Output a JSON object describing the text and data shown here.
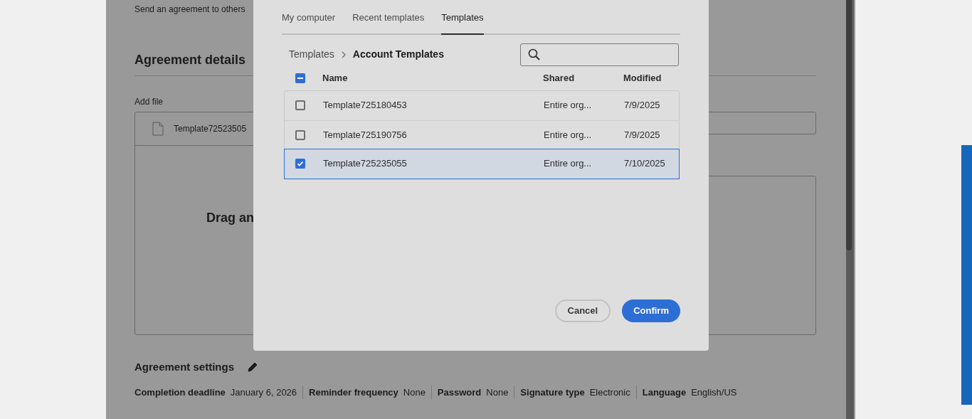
{
  "background_page": {
    "description": "Send an agreement to others",
    "section_title": "Agreement details",
    "add_file": {
      "label": "Add file",
      "file_name": "Template72523505",
      "drop_text": "Drag an"
    },
    "settings": {
      "title": "Agreement settings",
      "items": [
        {
          "label": "Completion deadline",
          "value": "January 6, 2026"
        },
        {
          "label": "Reminder frequency",
          "value": "None"
        },
        {
          "label": "Password",
          "value": "None"
        },
        {
          "label": "Signature type",
          "value": "Electronic"
        },
        {
          "label": "Language",
          "value": "English/US"
        }
      ]
    }
  },
  "dialog": {
    "tabs": [
      {
        "label": "My computer",
        "selected": false
      },
      {
        "label": "Recent templates",
        "selected": false
      },
      {
        "label": "Templates",
        "selected": true
      }
    ],
    "breadcrumb": [
      "Templates",
      "Account Templates"
    ],
    "table": {
      "select_all_indeterminate": true,
      "columns": [
        "Name",
        "Shared",
        "Modified"
      ],
      "rows": [
        {
          "name": "Template725180453",
          "shared": "Entire org...",
          "modified": "7/9/2025",
          "checked": false,
          "selected": false
        },
        {
          "name": "Template725190756",
          "shared": "Entire org...",
          "modified": "7/9/2025",
          "checked": false,
          "selected": false
        },
        {
          "name": "Template725235055",
          "shared": "Entire org...",
          "modified": "7/10/2025",
          "checked": true,
          "selected": true
        }
      ]
    },
    "buttons": [
      {
        "label": "Cancel",
        "kind": "secondary"
      },
      {
        "label": "Confirm",
        "kind": "primary"
      }
    ]
  }
}
